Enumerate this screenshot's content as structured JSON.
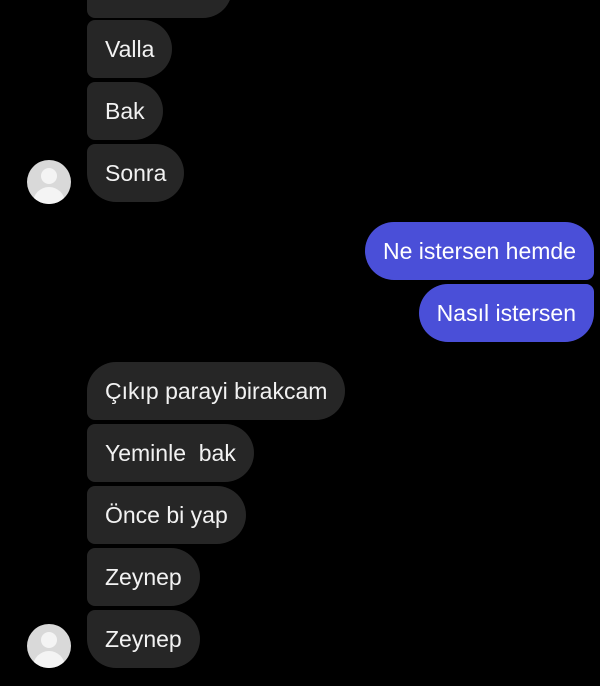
{
  "messages": {
    "group1": [
      "Valla",
      "Bak",
      "Sonra"
    ],
    "sent": [
      "Ne istersen hemde",
      "Nasıl istersen"
    ],
    "group2": [
      "Çıkıp parayi birakcam",
      "Yeminle  bak",
      "Önce bi yap",
      "Zeynep",
      "Zeynep"
    ]
  },
  "colors": {
    "background": "#000000",
    "incoming_bubble": "#262626",
    "outgoing_bubble": "#4a4fd8",
    "text": "#f2f2f2"
  },
  "icons": {
    "avatar": "user-avatar-icon"
  }
}
